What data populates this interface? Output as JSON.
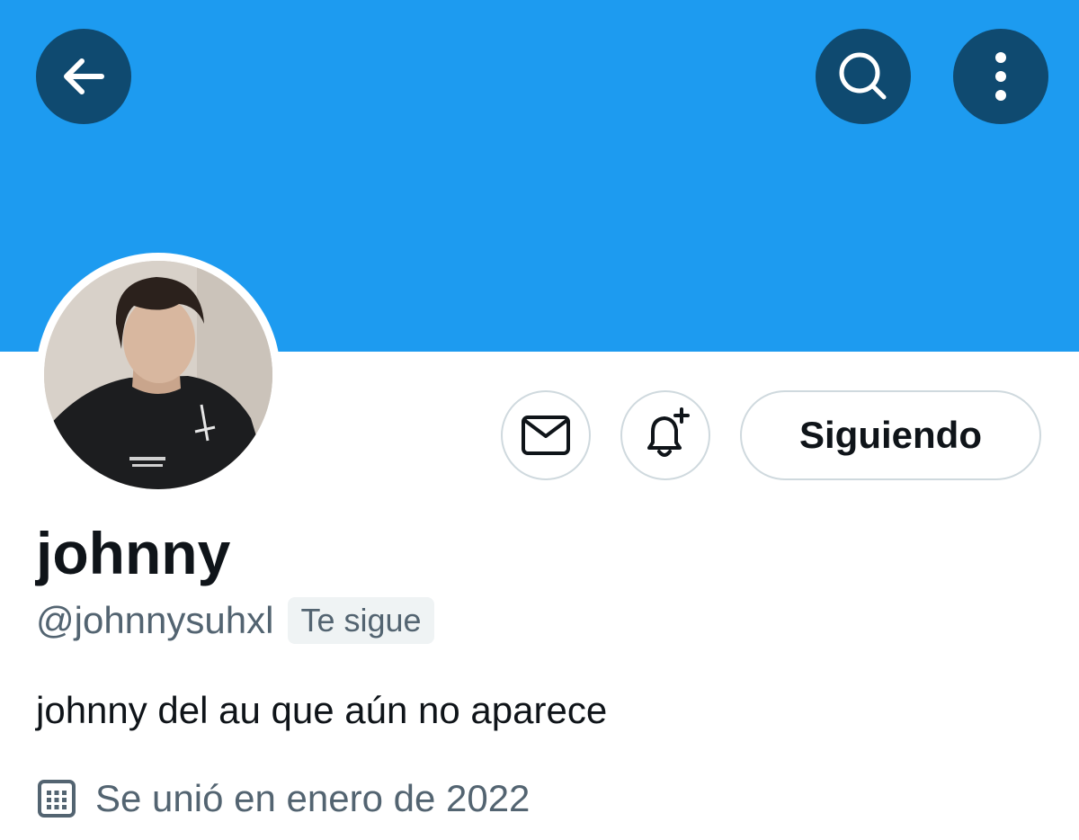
{
  "colors": {
    "banner": "#1d9bf0",
    "overlay_button": "#0f4a70",
    "text_primary": "#0f1419",
    "text_secondary": "#536471",
    "border": "#cfd9de"
  },
  "topbar": {
    "back_icon": "arrow-left-icon",
    "search_icon": "search-icon",
    "more_icon": "more-vertical-icon"
  },
  "actions": {
    "message_icon": "envelope-icon",
    "notify_icon": "bell-plus-icon",
    "follow_label": "Siguiendo"
  },
  "profile": {
    "display_name": "johnny",
    "handle": "@johnnysuhxl",
    "follows_you": "Te sigue",
    "bio": "johnny del au que aún no aparece",
    "joined_icon": "calendar-icon",
    "joined": "Se unió en enero de 2022"
  }
}
